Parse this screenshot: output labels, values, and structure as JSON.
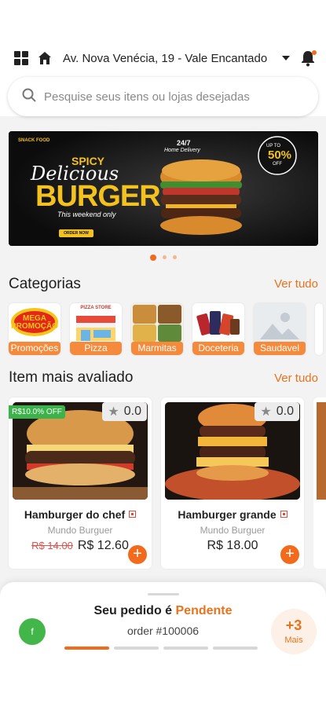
{
  "header": {
    "address": "Av. Nova Venécia, 19 - Vale Encantado",
    "icons": [
      "grid-icon",
      "home-icon",
      "chevron-down-icon",
      "bell-icon"
    ]
  },
  "search": {
    "placeholder": "Pesquise seus itens ou lojas desejadas"
  },
  "banner": {
    "brand": "SNACK FOOD",
    "line1": "SPICY",
    "line2": "Delicious",
    "line3": "BURGER",
    "tagline": "This weekend only",
    "badge_small": "24/7",
    "badge_small2": "Home Delivery",
    "offer_top": "UP TO",
    "offer_value": "50%",
    "offer_bottom": "OFF",
    "cta": "ORDER NOW",
    "slides": 3,
    "active_slide": 1
  },
  "categories": {
    "title": "Categorias",
    "see_all": "Ver tudo",
    "items": [
      {
        "label": "Promoções",
        "logo_text": "MEGA PROMOÇÃO"
      },
      {
        "label": "Pizza",
        "logo_text": "PIZZA STORE"
      },
      {
        "label": "Marmitas"
      },
      {
        "label": "Doceteria"
      },
      {
        "label": "Saudavel"
      }
    ]
  },
  "top_rated": {
    "title": "Item mais avaliado",
    "see_all": "Ver tudo",
    "items": [
      {
        "name": "Hamburger do chef",
        "store": "Mundo Burguer",
        "old_price": "R$ 14.00",
        "price": "R$ 12.60",
        "rating": "0.0",
        "discount": "R$10.0% OFF"
      },
      {
        "name": "Hamburger grande",
        "store": "Mundo Burguer",
        "price": "R$ 18.00",
        "rating": "0.0"
      }
    ]
  },
  "order": {
    "avatar": "f",
    "prefix": "Seu pedido é ",
    "status": "Pendente",
    "number": "order #100006",
    "steps": 4,
    "active_steps": 1,
    "more_count": "+3",
    "more_label": "Mais"
  },
  "colors": {
    "accent": "#f26b1d",
    "text": "#222222",
    "muted": "#9b9b9b",
    "bg": "#f3f3f3"
  }
}
